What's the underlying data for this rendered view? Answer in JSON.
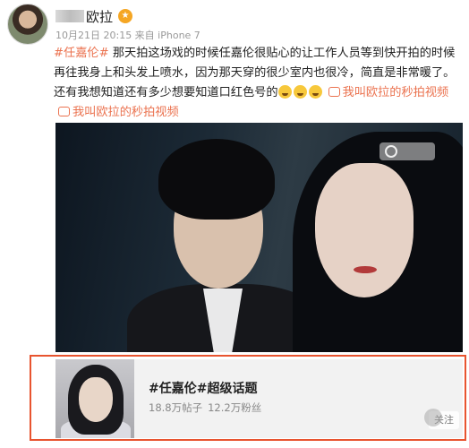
{
  "post": {
    "author_name": "欧拉",
    "meta": "10月21日 20:15 来自 iPhone 7",
    "hashtag": "#任嘉伦#",
    "body": " 那天拍这场戏的时候任嘉伦很贴心的让工作人员等到快开拍的时候再往我身上和头发上喷水，因为那天穿的很少室内也很冷，简直是非常暖了。还有我想知道还有多少想要知道口红色号的",
    "link_label_1": "我叫欧拉的秒拍视频",
    "link_label_2": "我叫欧拉的秒拍视频"
  },
  "topic": {
    "title": "#任嘉伦#超级话题",
    "posts": "18.8万帖子",
    "fans": "12.2万粉丝",
    "follow_label": "关注"
  },
  "colors": {
    "accent": "#eb7350",
    "highlight_box": "#e8542f"
  },
  "icons": [
    "fan-badge-icon",
    "laugh-cry-emoji-icon",
    "video-link-icon"
  ]
}
